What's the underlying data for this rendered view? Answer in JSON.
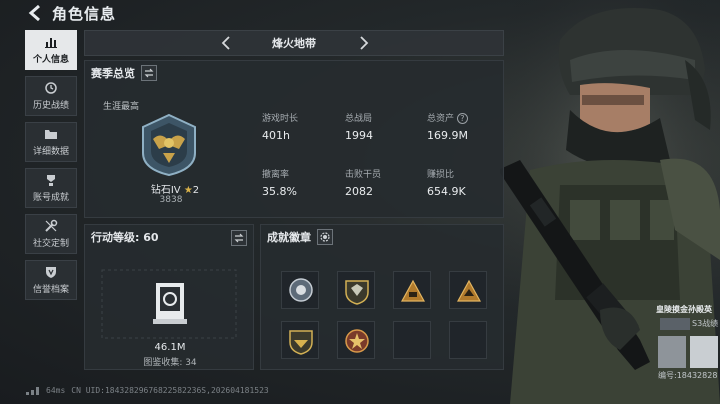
{
  "header": {
    "title": "角色信息"
  },
  "sidebar": {
    "items": [
      {
        "label": "个人信息",
        "icon": "bar-chart-icon"
      },
      {
        "label": "历史战绩",
        "icon": "history-icon"
      },
      {
        "label": "详细数据",
        "icon": "folder-icon"
      },
      {
        "label": "账号成就",
        "icon": "achievement-icon"
      },
      {
        "label": "社交定制",
        "icon": "wrench-icon"
      },
      {
        "label": "信誉档案",
        "icon": "shield-icon"
      }
    ]
  },
  "map_selector": {
    "name": "烽火地带"
  },
  "season": {
    "title": "赛季总览",
    "career_best_label": "生涯最高",
    "rank_name": "钻石IV",
    "rank_stars": "2",
    "rank_points": "3838",
    "stats": [
      {
        "label": "游戏时长",
        "value": "401h"
      },
      {
        "label": "总战局",
        "value": "1994"
      },
      {
        "label": "总资产",
        "value": "169.9M",
        "has_help": true
      },
      {
        "label": "撤离率",
        "value": "35.8%"
      },
      {
        "label": "击败干员",
        "value": "2082"
      },
      {
        "label": "赚损比",
        "value": "654.9K"
      }
    ],
    "help_symbol": "?"
  },
  "action": {
    "title_prefix": "行动等级:",
    "level": "60",
    "value": "46.1M",
    "collection": "图鉴收集: 34"
  },
  "achievements": {
    "title": "成就徽章"
  },
  "character": {
    "name": "皇陵摸金孙殿英",
    "server": "S3战绩",
    "id_label": "编号:18432828"
  },
  "status_bar": {
    "ping": "64ms",
    "uid": "CN UID:18432829676822582236S,202604181523"
  },
  "colors": {
    "accent_gold": "#d9b24a",
    "active_tab": "#e6e8ea"
  }
}
